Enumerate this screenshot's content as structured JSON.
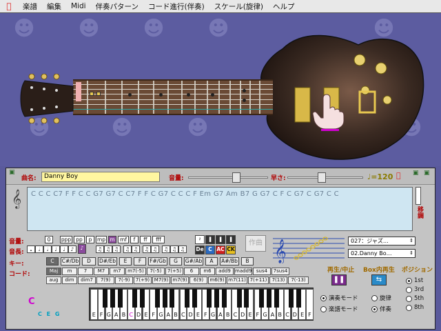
{
  "menubar": {
    "items": [
      "楽譜",
      "編集",
      "Midi",
      "伴奏パターン",
      "コード進行(伴奏)",
      "スケール(旋律)",
      "ヘルプ"
    ]
  },
  "colors": {
    "desktop": "#5c5ca0",
    "panel": "#c4c4c4",
    "chord_area": "#cfe6f2",
    "song_field": "#fff6a0",
    "highlight": "#8a4a9c",
    "accent": "#d000d0"
  },
  "panel": {
    "song_label": "曲名:",
    "song_name": "Danny Boy",
    "volume_label": "音量:",
    "volume_level": 0.62,
    "speed_label": "早さ:",
    "speed_level": 0.45,
    "tempo_value": "120",
    "chords_text": "C C C C7 F F C C G7 G7 C C7 F F C G7 C C C F Em G7 Am B7 G G7 C F C G7 C G7 C C",
    "modulation_label": "移調",
    "dynamics_label": "音量:",
    "dynamics": [
      "0",
      "ppp",
      "pp",
      "p",
      "mp",
      "m",
      "mf",
      "f",
      "ff",
      "fff"
    ],
    "dynamics_selected": 5,
    "duration_label": "音長:",
    "key_label": "キー:",
    "keys": [
      "C",
      "C#/Db",
      "D",
      "D#/Eb",
      "E",
      "F",
      "F#/Gb",
      "G",
      "G#/Ab",
      "A",
      "A#/Bb",
      "B"
    ],
    "key_selected": 0,
    "chord_label": "コード:",
    "chords_row1": [
      "Maj",
      "m",
      "7",
      "M7",
      "m7",
      "m7(-5)",
      "7(-5)",
      "7(+5)",
      "6",
      "m6",
      "add9",
      "madd9",
      "sus4",
      "7sus4"
    ],
    "chords_row2": [
      "aug",
      "dim",
      "dim7",
      "7(9)",
      "7(-9)",
      "7(+9)",
      "M7(9)",
      "m7(9)",
      "6(9)",
      "m6(9)",
      "m7(11)",
      "7(+11)",
      "7(13)",
      "7(-13)"
    ],
    "chord_selected": 0,
    "compose_label": "作曲",
    "pattern_selected": "027：ジャズ…",
    "song_selected": "02.Danny Bo…",
    "play_label": "再生/中止",
    "box_play_label": "Box内再生",
    "position_label": "ポジション",
    "positions": [
      "1st",
      "3rd",
      "5th",
      "8th"
    ],
    "position_selected": 0,
    "mode_perform": "演奏モード",
    "mode_score": "楽譜モード",
    "melody_label": "旋律",
    "accomp_label": "伴奏",
    "current_chord": "C",
    "chord_tones": "C E G",
    "de_label": "De",
    "c_label": "C",
    "ac_label": "AC",
    "ck_label": "CK",
    "piano_keys": [
      "E",
      "F",
      "G",
      "A",
      "B",
      "C",
      "D",
      "E",
      "F",
      "G",
      "A",
      "B",
      "C",
      "D",
      "E",
      "F",
      "G",
      "A",
      "B",
      "C",
      "D",
      "E",
      "F",
      "G",
      "A",
      "B",
      "C",
      "D",
      "E",
      "F"
    ]
  }
}
